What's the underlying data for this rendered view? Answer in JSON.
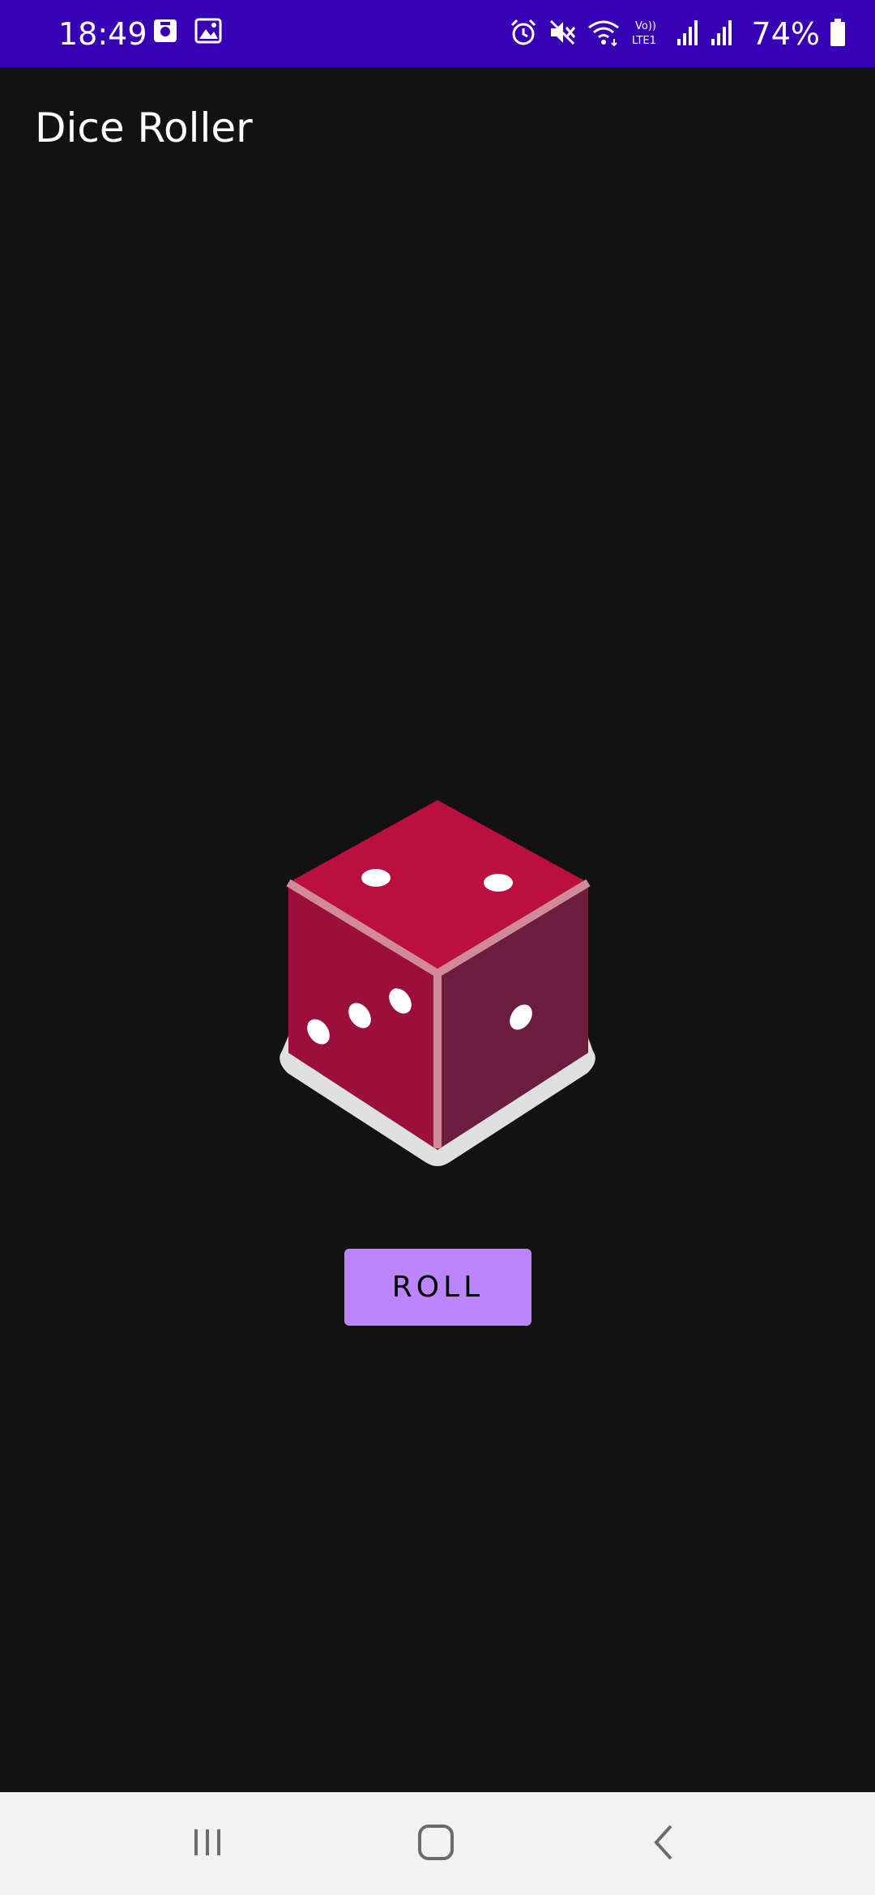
{
  "status_bar": {
    "time": "18:49",
    "battery": "74%",
    "background": "#3700b3",
    "left_icons": [
      "screenshot-icon",
      "gallery-icon"
    ],
    "right_icons": [
      "alarm-icon",
      "mute-icon",
      "wifi-icon",
      "volte-icon",
      "signal-icon-1",
      "signal-icon-2",
      "battery-icon"
    ]
  },
  "app_bar": {
    "title": "Dice Roller"
  },
  "dice": {
    "face_top_pips": 2,
    "face_left_pips": 3,
    "face_right_pips": 1,
    "top_color": "#bb0f3f",
    "left_color": "#9b0f3d",
    "right_color": "#6c1d3d",
    "edge_color": "#d18a97",
    "shadow_color": "#e0e0e0"
  },
  "roll_button": {
    "label": "ROLL",
    "color": "#bb86fc"
  },
  "nav_bar": {
    "items": [
      "recents-icon",
      "home-icon",
      "back-icon"
    ]
  }
}
